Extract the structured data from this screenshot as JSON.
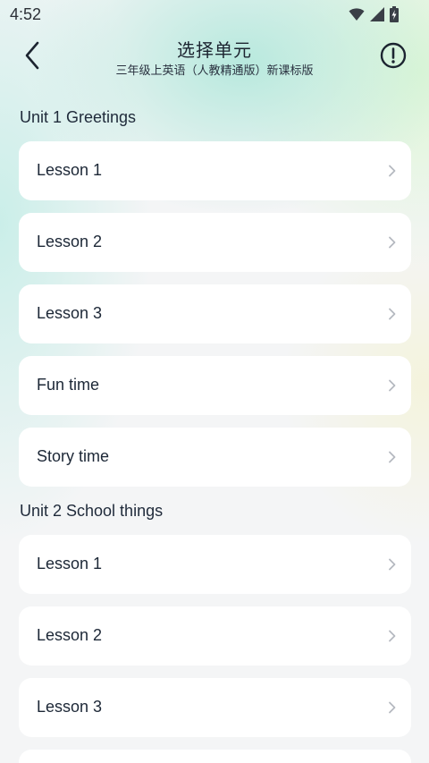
{
  "status_bar": {
    "time": "4:52"
  },
  "header": {
    "title": "选择单元",
    "subtitle": "三年级上英语（人教精通版）新课标版",
    "back_icon": "chevron-left-icon",
    "info_icon": "exclamation-circle-icon"
  },
  "sections": [
    {
      "title": "Unit 1 Greetings",
      "items": [
        "Lesson 1",
        "Lesson 2",
        "Lesson 3",
        "Fun time",
        "Story time"
      ]
    },
    {
      "title": "Unit 2 School things",
      "items": [
        "Lesson 1",
        "Lesson 2",
        "Lesson 3"
      ]
    }
  ],
  "colors": {
    "card_bg": "#ffffff",
    "page_bg": "#f4f5f6",
    "text_primary": "#1c2736",
    "chevron": "#b5b9c0"
  }
}
